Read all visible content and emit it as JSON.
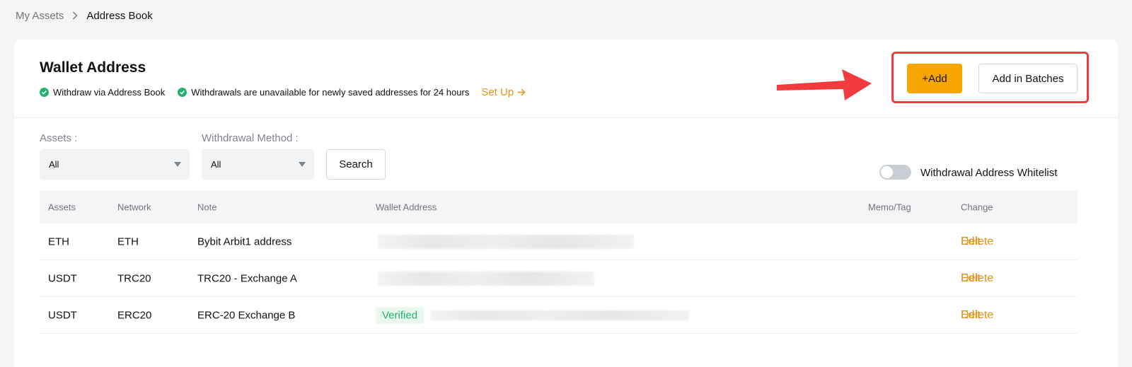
{
  "breadcrumb": {
    "parent": "My Assets",
    "current": "Address Book"
  },
  "header": {
    "title": "Wallet Address",
    "note1": "Withdraw via Address Book",
    "note2": "Withdrawals are unavailable for newly saved addresses for 24 hours",
    "setup_link": "Set Up"
  },
  "actions": {
    "add_label": "+Add",
    "batches_label": "Add in Batches"
  },
  "filters": {
    "assets_label": "Assets :",
    "assets_value": "All",
    "method_label": "Withdrawal Method :",
    "method_value": "All",
    "search_label": "Search"
  },
  "whitelist": {
    "label": "Withdrawal Address Whitelist",
    "enabled": false
  },
  "table": {
    "headers": [
      "Assets",
      "Network",
      "Note",
      "Wallet Address",
      "Memo/Tag",
      "Change"
    ],
    "rows": [
      {
        "asset": "ETH",
        "network": "ETH",
        "note": "Bybit Arbit1 address",
        "verified": ""
      },
      {
        "asset": "USDT",
        "network": "TRC20",
        "note": "TRC20 - Exchange A",
        "verified": ""
      },
      {
        "asset": "USDT",
        "network": "ERC20",
        "note": "ERC-20 Exchange B",
        "verified": "Verified"
      }
    ],
    "edit_label": "Edit",
    "delete_label": "Delete"
  },
  "colors": {
    "accent": "#f7a600",
    "link": "#e59217",
    "success": "#20b26c",
    "annotation": "#f13b3f"
  }
}
